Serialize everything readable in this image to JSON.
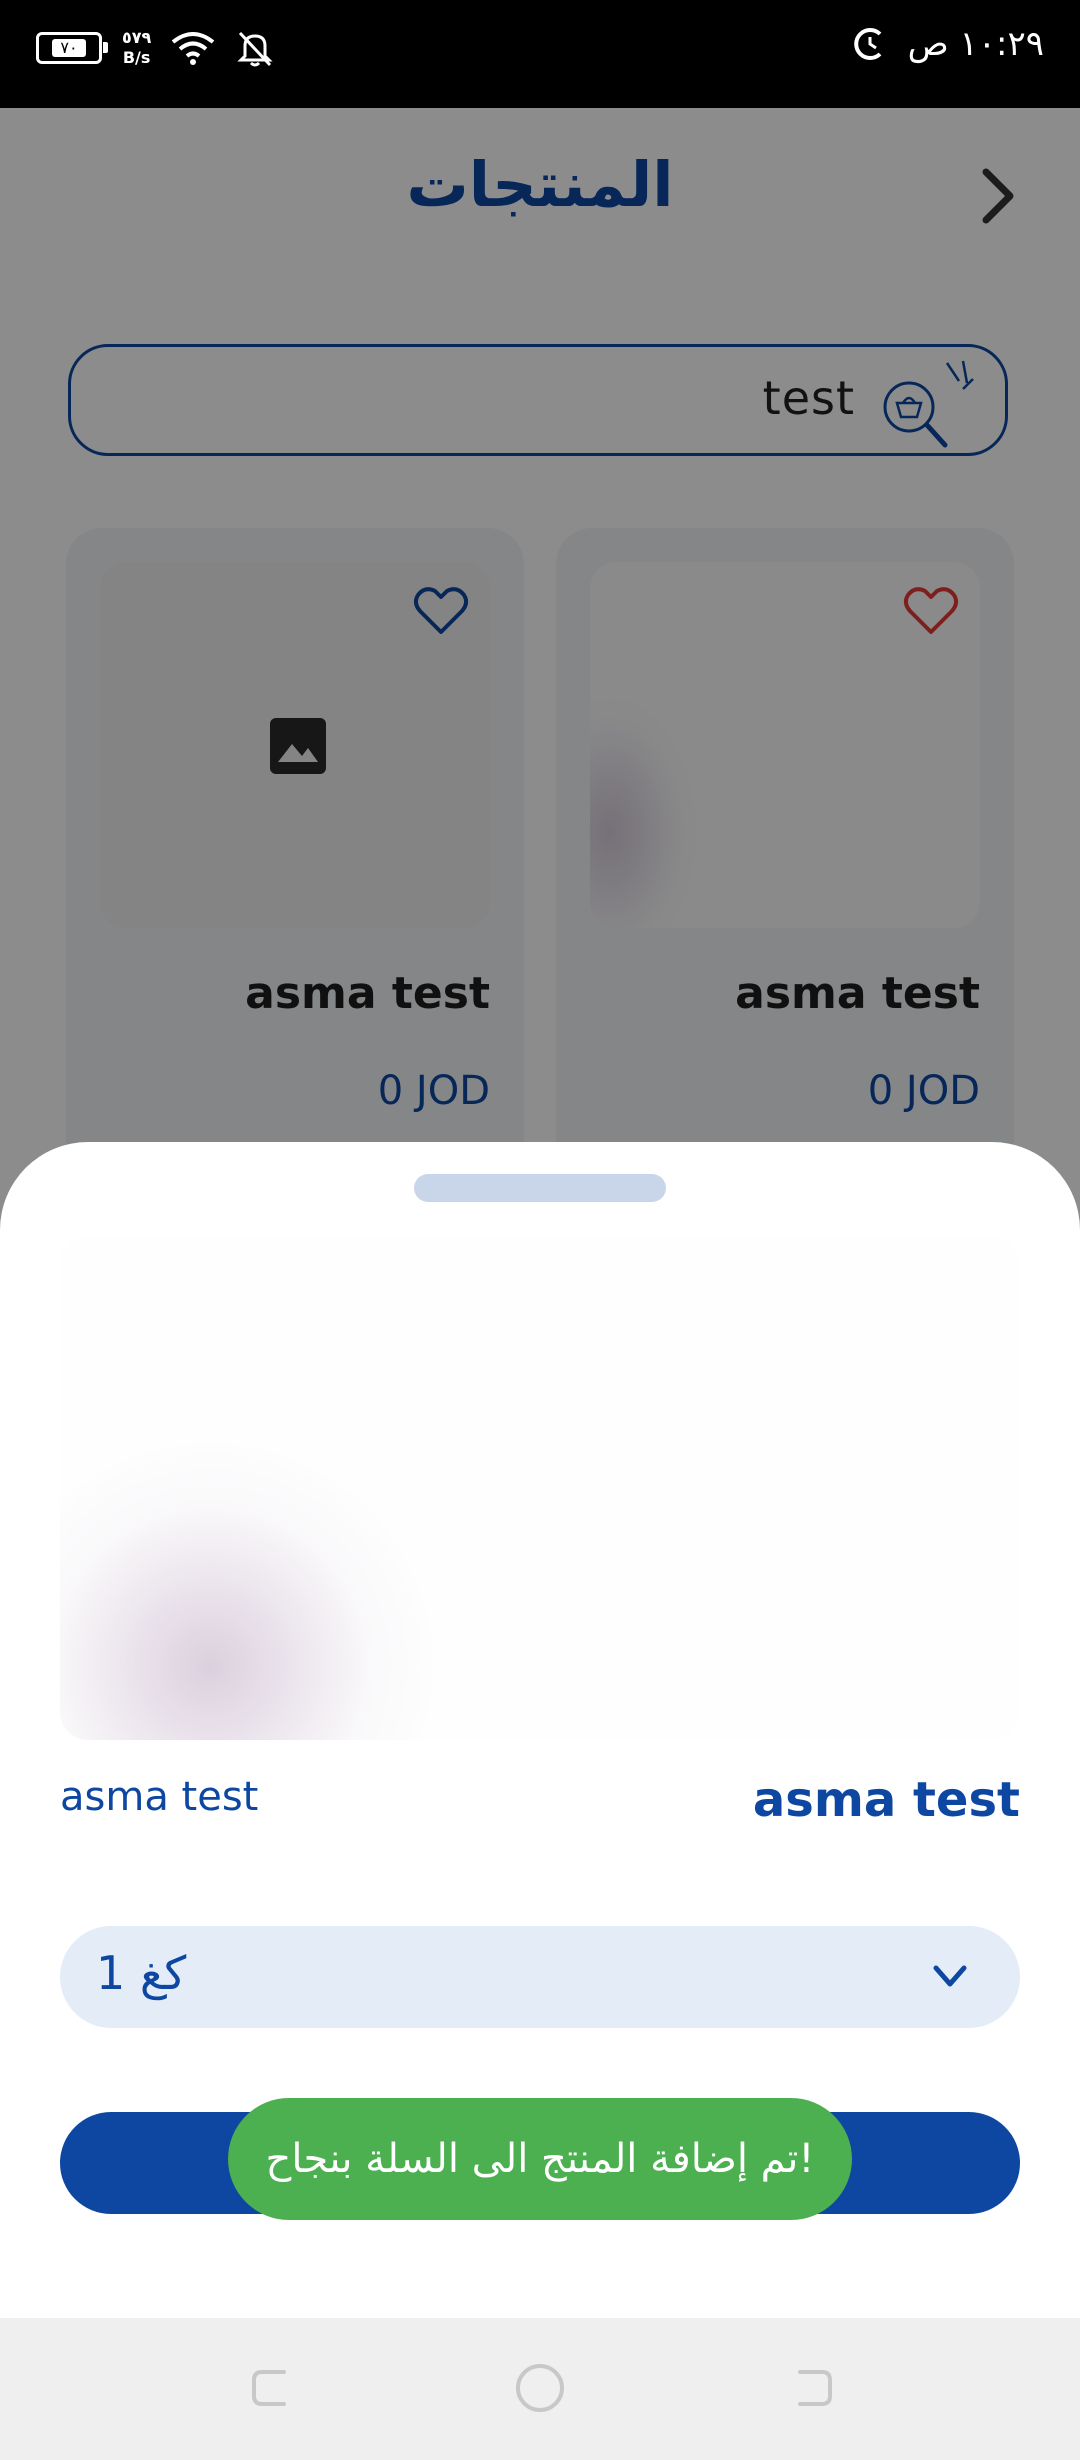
{
  "status_bar": {
    "battery": "٧٠",
    "net_speed_value": "٥٧٩",
    "net_speed_unit": "B/s",
    "time": "١٠:٢٩ ص",
    "icons": [
      "battery-icon",
      "wifi-icon",
      "notifications-off-icon",
      "alarm-icon"
    ]
  },
  "header": {
    "title": "المنتجات",
    "back_icon": "chevron-right-icon"
  },
  "search": {
    "value": "test",
    "icon": "basket-search-icon"
  },
  "products": [
    {
      "name": "asma test",
      "price": "0 JOD",
      "favorite": false,
      "image": "image-placeholder-icon"
    },
    {
      "name": "asma test",
      "price": "0 JOD",
      "favorite": true,
      "image": "product-photo"
    }
  ],
  "sheet": {
    "product_name": "asma test",
    "product_description": "asma test",
    "unit_select_value": "كغ 1",
    "add_button_label": "",
    "toast": "!تم إضافة المنتج الى السلة بنجاح"
  },
  "colors": {
    "primary": "#0d47a1",
    "toast": "#4caf50",
    "favorite_active": "#e53935",
    "dropdown_bg": "#e3ecf7"
  },
  "nav_bar": {
    "buttons": [
      "recents-button",
      "home-button",
      "back-button"
    ]
  }
}
